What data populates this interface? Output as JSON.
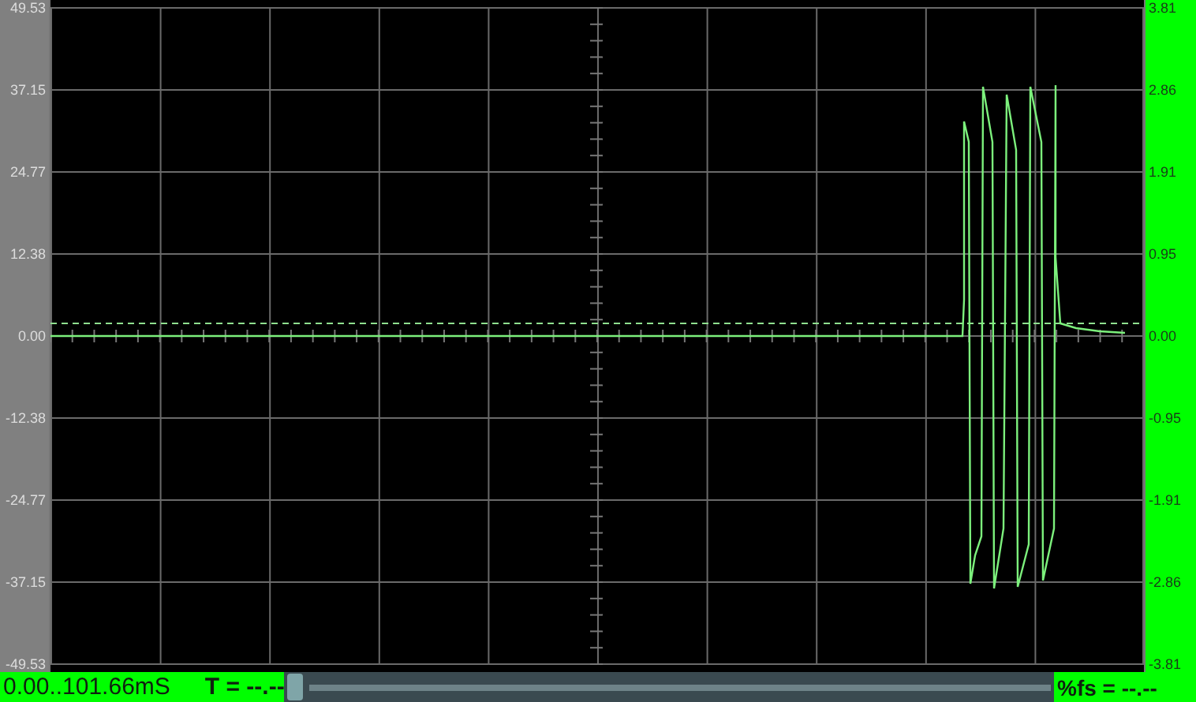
{
  "left_axis": {
    "ticks": [
      "49.53",
      "37.15",
      "24.77",
      "12.38",
      "0.00",
      "-12.38",
      "-24.77",
      "-37.15",
      "-49.53"
    ]
  },
  "right_axis": {
    "ticks": [
      "3.81",
      "2.86",
      "1.91",
      "0.95",
      "0.00",
      "-0.95",
      "-1.91",
      "-2.86",
      "-3.81"
    ]
  },
  "status_bar": {
    "time_range": "0.00..101.66mS",
    "period": "T = --.--",
    "percent_fs": "%fs = --.--"
  }
}
